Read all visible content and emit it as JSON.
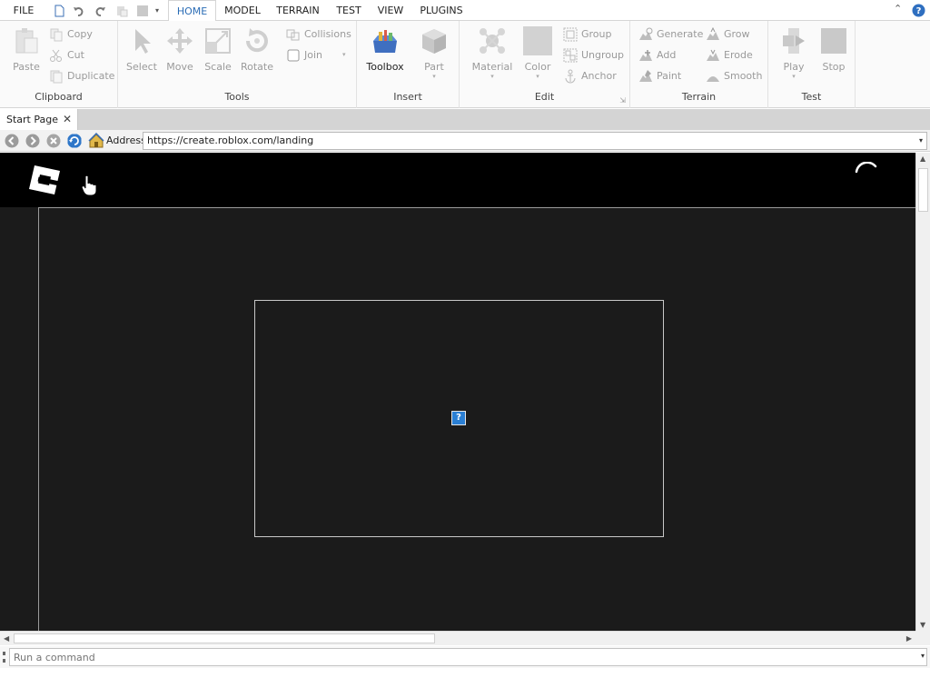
{
  "menu": {
    "tabs": [
      {
        "label": "FILE"
      },
      {
        "label": "HOME"
      },
      {
        "label": "MODEL"
      },
      {
        "label": "TERRAIN"
      },
      {
        "label": "TEST"
      },
      {
        "label": "VIEW"
      },
      {
        "label": "PLUGINS"
      }
    ],
    "active": "HOME"
  },
  "ribbon": {
    "clipboard": {
      "label": "Clipboard",
      "paste": "Paste",
      "copy": "Copy",
      "cut": "Cut",
      "duplicate": "Duplicate"
    },
    "tools": {
      "label": "Tools",
      "select": "Select",
      "move": "Move",
      "scale": "Scale",
      "rotate": "Rotate",
      "collisions": "Collisions",
      "join": "Join"
    },
    "insert": {
      "label": "Insert",
      "toolbox": "Toolbox",
      "part": "Part"
    },
    "edit": {
      "label": "Edit",
      "material": "Material",
      "color": "Color",
      "group": "Group",
      "ungroup": "Ungroup",
      "anchor": "Anchor"
    },
    "terrain": {
      "label": "Terrain",
      "generate": "Generate",
      "add": "Add",
      "paint": "Paint",
      "grow": "Grow",
      "erode": "Erode",
      "smooth": "Smooth"
    },
    "test": {
      "label": "Test",
      "play": "Play",
      "stop": "Stop"
    }
  },
  "document_tab": {
    "label": "Start Page"
  },
  "address_bar": {
    "label": "Address",
    "url": "https://create.roblox.com/landing"
  },
  "command_bar": {
    "placeholder": "Run a command"
  },
  "icons": [
    "file-icon",
    "undo-icon",
    "redo-icon",
    "help-icon",
    "roblox-logo-icon",
    "loading-spinner-icon",
    "broken-image-icon"
  ],
  "colors": {
    "accent": "#2a6cb5",
    "page_bg": "#1b1b1b",
    "topbar_bg": "#000000"
  }
}
